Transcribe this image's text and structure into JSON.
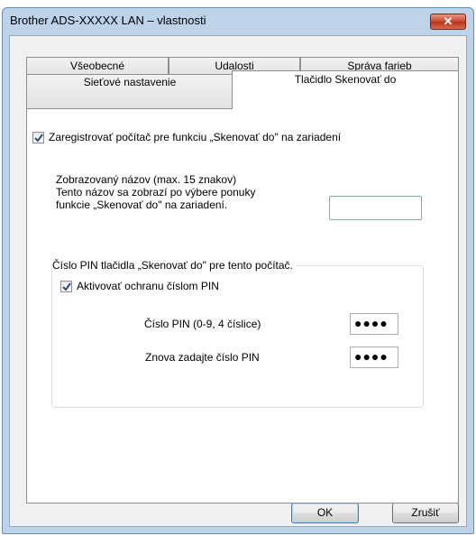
{
  "window": {
    "title": "Brother ADS-XXXXX LAN – vlastnosti",
    "close_label": "✕"
  },
  "tabs": {
    "row1": [
      "Všeobecné",
      "Udalosti",
      "Správa farieb"
    ],
    "row2": [
      "Sieťové nastavenie",
      "Tlačidlo Skenovať do"
    ],
    "active": "Tlačidlo Skenovať do"
  },
  "register": {
    "label": "Zaregistrovať počítač pre funkciu „Skenovať do\" na zariadení",
    "checked": true
  },
  "display_name": {
    "line1": "Zobrazovaný názov (max. 15 znakov)",
    "line2": "Tento názov sa zobrazí po výbere ponuky",
    "line3": "funkcie „Skenovať do\" na zariadení.",
    "value": ""
  },
  "pin_group": {
    "legend": "Číslo PIN tlačidla „Skenovať do\" pre tento počítač.",
    "protect_label": "Aktivovať ochranu číslom PIN",
    "protect_checked": true,
    "pin_label": "Číslo PIN (0-9, 4 číslice)",
    "pin_value": "●●●●",
    "repin_label": "Znova zadajte číslo PIN",
    "repin_value": "●●●●"
  },
  "buttons": {
    "ok": "OK",
    "cancel": "Zrušiť"
  },
  "colors": {
    "title_bar": "#bcd3ea",
    "close_button": "#c9482e",
    "check": "#2a4a8a"
  }
}
